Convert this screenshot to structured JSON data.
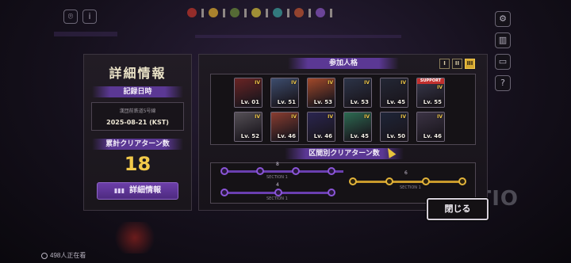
{
  "hud": {
    "colors": [
      "#c8362b",
      "#e4b02f",
      "#6c8e3a",
      "#d6c23a",
      "#3aa2a0",
      "#c45531",
      "#8b57c6"
    ]
  },
  "left_panel": {
    "title": "詳細情報",
    "record_label": "記録日時",
    "route": "漢団前鉄道5号線",
    "date": "2025-08-21 (KST)",
    "cumulative_label": "累計クリアターン数",
    "turn_count": "18",
    "detail_button": "詳細情報"
  },
  "right_panel": {
    "participants_label": "参加人格",
    "page_tabs": [
      "I",
      "II",
      "III"
    ],
    "active_tab": "III",
    "characters": [
      {
        "level": "Lv. 01",
        "rank": "IV",
        "support": "",
        "color": "#6a2424"
      },
      {
        "level": "Lv. 51",
        "rank": "IV",
        "support": "",
        "color": "#3d4d6e"
      },
      {
        "level": "Lv. 53",
        "rank": "IV",
        "support": "",
        "color": "#a3492a"
      },
      {
        "level": "Lv. 53",
        "rank": "IV",
        "support": "",
        "color": "#2c3448"
      },
      {
        "level": "Lv. 45",
        "rank": "IV",
        "support": "",
        "color": "#232735"
      },
      {
        "level": "Lv. 55",
        "rank": "IV",
        "support": "SUPPORT",
        "color": "#3a3b4f"
      },
      {
        "level": "Lv. 52",
        "rank": "IV",
        "support": "",
        "color": "#555056"
      },
      {
        "level": "Lv. 46",
        "rank": "IV",
        "support": "",
        "color": "#8a3d30"
      },
      {
        "level": "Lv. 46",
        "rank": "IV",
        "support": "",
        "color": "#2a2550"
      },
      {
        "level": "Lv. 45",
        "rank": "IV",
        "support": "",
        "color": "#2d6b52"
      },
      {
        "level": "Lv. 50",
        "rank": "IV",
        "support": "",
        "color": "#1e2538"
      },
      {
        "level": "Lv. 46",
        "rank": "IV",
        "support": "",
        "color": "#3b3344"
      }
    ],
    "section_turns_label": "区間別クリアターン数",
    "section_numbers": [
      "8",
      "6",
      "4"
    ],
    "section_caption": "SECTION 1"
  },
  "close_button": "閉じる",
  "viewers": "498人正在看"
}
